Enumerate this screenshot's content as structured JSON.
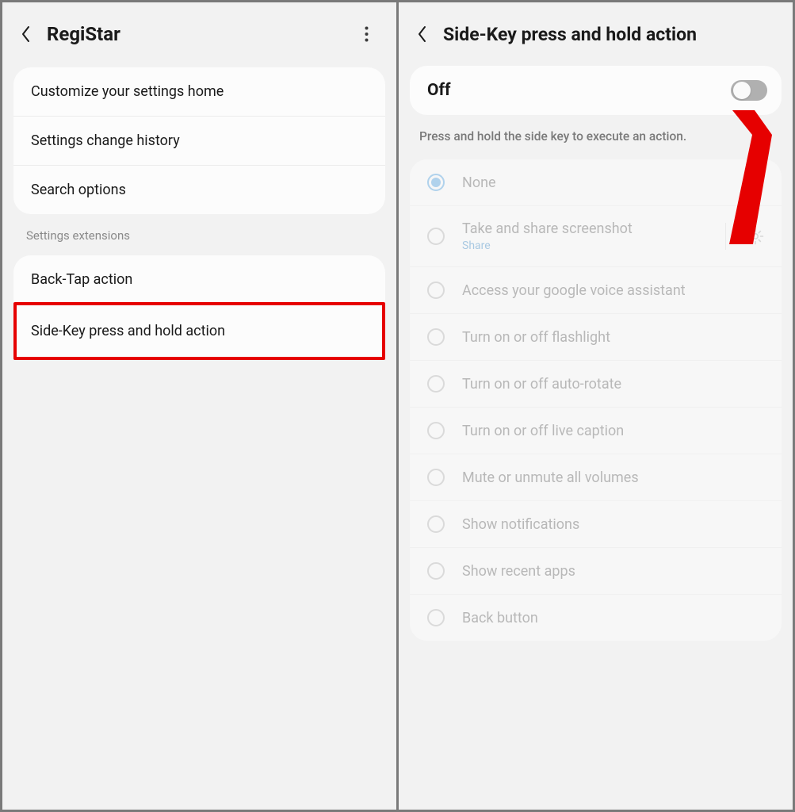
{
  "left": {
    "title": "RegiStar",
    "items": [
      "Customize your settings home",
      "Settings change history",
      "Search options"
    ],
    "section_label": "Settings extensions",
    "ext_items": [
      "Back-Tap action",
      "Side-Key press and hold action"
    ]
  },
  "right": {
    "title": "Side-Key press and hold action",
    "toggle_label": "Off",
    "toggle_on": false,
    "help_text": "Press and hold the side key to execute an action.",
    "options": [
      {
        "label": "None",
        "selected": true
      },
      {
        "label": "Take and share screenshot",
        "sub": "Share",
        "gear": true
      },
      {
        "label": "Access your google voice assistant"
      },
      {
        "label": "Turn on or off flashlight"
      },
      {
        "label": "Turn on or off auto-rotate"
      },
      {
        "label": "Turn on or off live caption"
      },
      {
        "label": "Mute or unmute all volumes"
      },
      {
        "label": "Show notifications"
      },
      {
        "label": "Show recent apps"
      },
      {
        "label": "Back button"
      }
    ]
  }
}
